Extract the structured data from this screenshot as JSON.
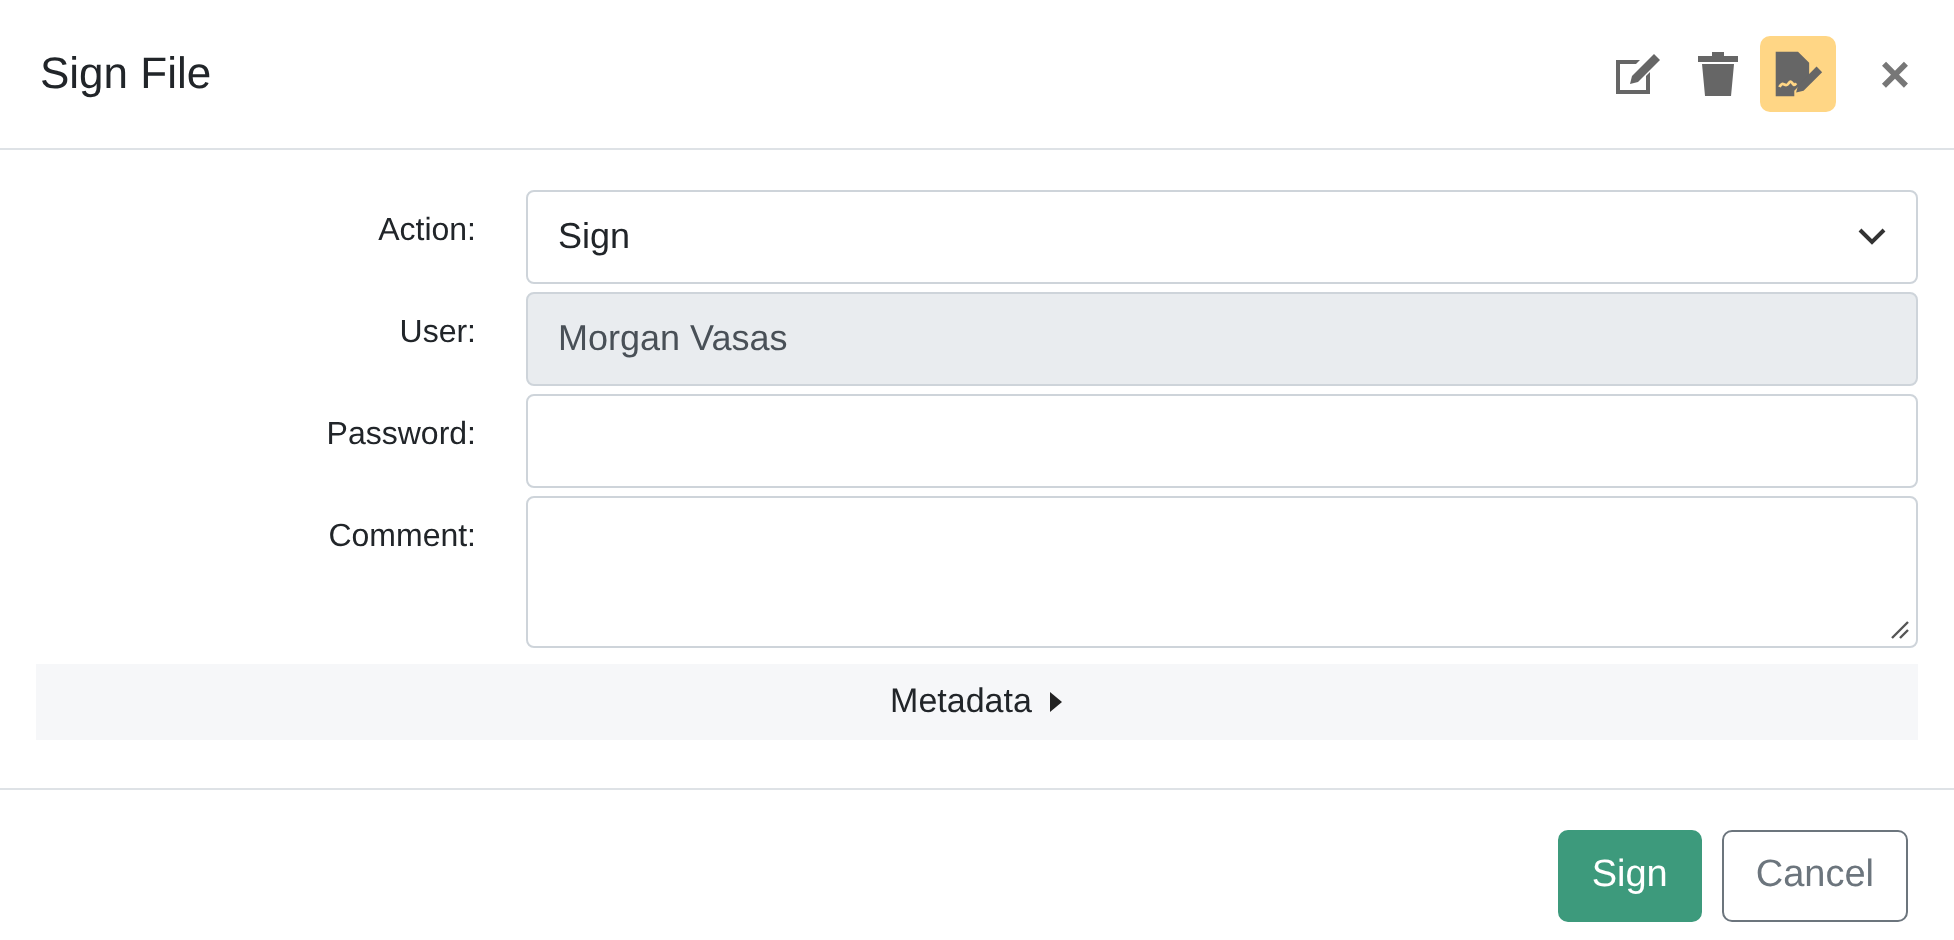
{
  "dialog": {
    "title": "Sign File",
    "close": "×"
  },
  "toolbar": [
    {
      "kind": "edit",
      "selected": false
    },
    {
      "kind": "delete",
      "selected": false
    },
    {
      "kind": "sign",
      "selected": true
    }
  ],
  "fields": [
    {
      "kind": "select",
      "label": "Action:",
      "value": "Sign",
      "disabled": false
    },
    {
      "kind": "text",
      "label": "User:",
      "value": "Morgan Vasas",
      "disabled": true
    },
    {
      "kind": "password",
      "label": "Password:",
      "disabled": false
    },
    {
      "kind": "textarea",
      "label": "Comment:",
      "disabled": false
    }
  ],
  "metadata": {
    "label": "Metadata",
    "expanded": false
  },
  "buttons": [
    {
      "kind": "primary",
      "label": "Sign"
    },
    {
      "kind": "secondary",
      "label": "Cancel"
    }
  ]
}
